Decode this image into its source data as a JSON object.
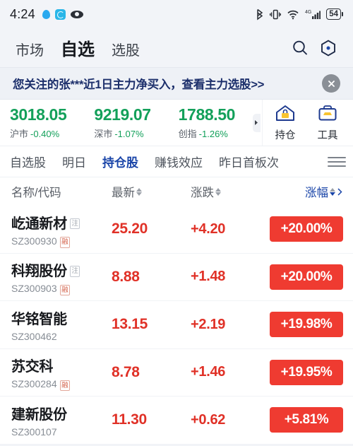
{
  "status_bar": {
    "time": "4:24",
    "left_icons": [
      "location-dot-icon",
      "messenger-app-icon",
      "eye-icon"
    ],
    "right_icons": [
      "bluetooth-icon",
      "vibrate-icon",
      "wifi-icon",
      "cellular-4g-icon"
    ],
    "battery_percent": "54",
    "network_label": "4G"
  },
  "top_nav": {
    "tabs": [
      {
        "label": "市场",
        "active": false
      },
      {
        "label": "自选",
        "active": true
      },
      {
        "label": "选股",
        "active": false
      }
    ],
    "icons": [
      "search-icon",
      "hexagon-scan-icon"
    ]
  },
  "banner": {
    "text": "您关注的张***近1日主力净买入，查看主力选股>>",
    "close_icon": "close-icon",
    "text_color": "#1c2f6b"
  },
  "index_bar": {
    "indices": [
      {
        "value": "3018.05",
        "name": "沪市",
        "change_pct": "-0.40%"
      },
      {
        "value": "9219.07",
        "name": "深市",
        "change_pct": "-1.07%"
      },
      {
        "value": "1788.50",
        "name": "创指",
        "change_pct": "-1.26%"
      }
    ],
    "scroll_arrow_icon": "chevron-right-icon",
    "down_color": "#13a05a",
    "tools": [
      {
        "label": "持仓",
        "icon": "house-holdings-icon"
      },
      {
        "label": "工具",
        "icon": "toolbox-icon"
      }
    ]
  },
  "sub_tabs": {
    "items": [
      {
        "label": "自选股",
        "active": false
      },
      {
        "label": "明日",
        "active": false
      },
      {
        "label": "持仓股",
        "active": true
      },
      {
        "label": "赚钱效应",
        "active": false
      },
      {
        "label": "昨日首板次",
        "active": false
      }
    ],
    "menu_icon": "hamburger-menu-icon",
    "active_color": "#1a45a8"
  },
  "table": {
    "headers": {
      "name": "名称/代码",
      "last": "最新",
      "change": "涨跌",
      "pct": "涨幅"
    },
    "sort_active_column": "涨幅",
    "sort_direction": "desc",
    "up_color": "#e03127",
    "pct_badge_color": "#ef3b31",
    "rows": [
      {
        "name": "屹通新材",
        "name_badge": "注",
        "code": "SZ300930",
        "code_badge": "融",
        "last": "25.20",
        "change": "+4.20",
        "pct": "+20.00%"
      },
      {
        "name": "科翔股份",
        "name_badge": "注",
        "code": "SZ300903",
        "code_badge": "融",
        "last": "8.88",
        "change": "+1.48",
        "pct": "+20.00%"
      },
      {
        "name": "华铭智能",
        "name_badge": "",
        "code": "SZ300462",
        "code_badge": "",
        "last": "13.15",
        "change": "+2.19",
        "pct": "+19.98%"
      },
      {
        "name": "苏交科",
        "name_badge": "",
        "code": "SZ300284",
        "code_badge": "融",
        "last": "8.78",
        "change": "+1.46",
        "pct": "+19.95%"
      },
      {
        "name": "建新股份",
        "name_badge": "",
        "code": "SZ300107",
        "code_badge": "",
        "last": "11.30",
        "change": "+0.62",
        "pct": "+5.81%"
      }
    ]
  }
}
